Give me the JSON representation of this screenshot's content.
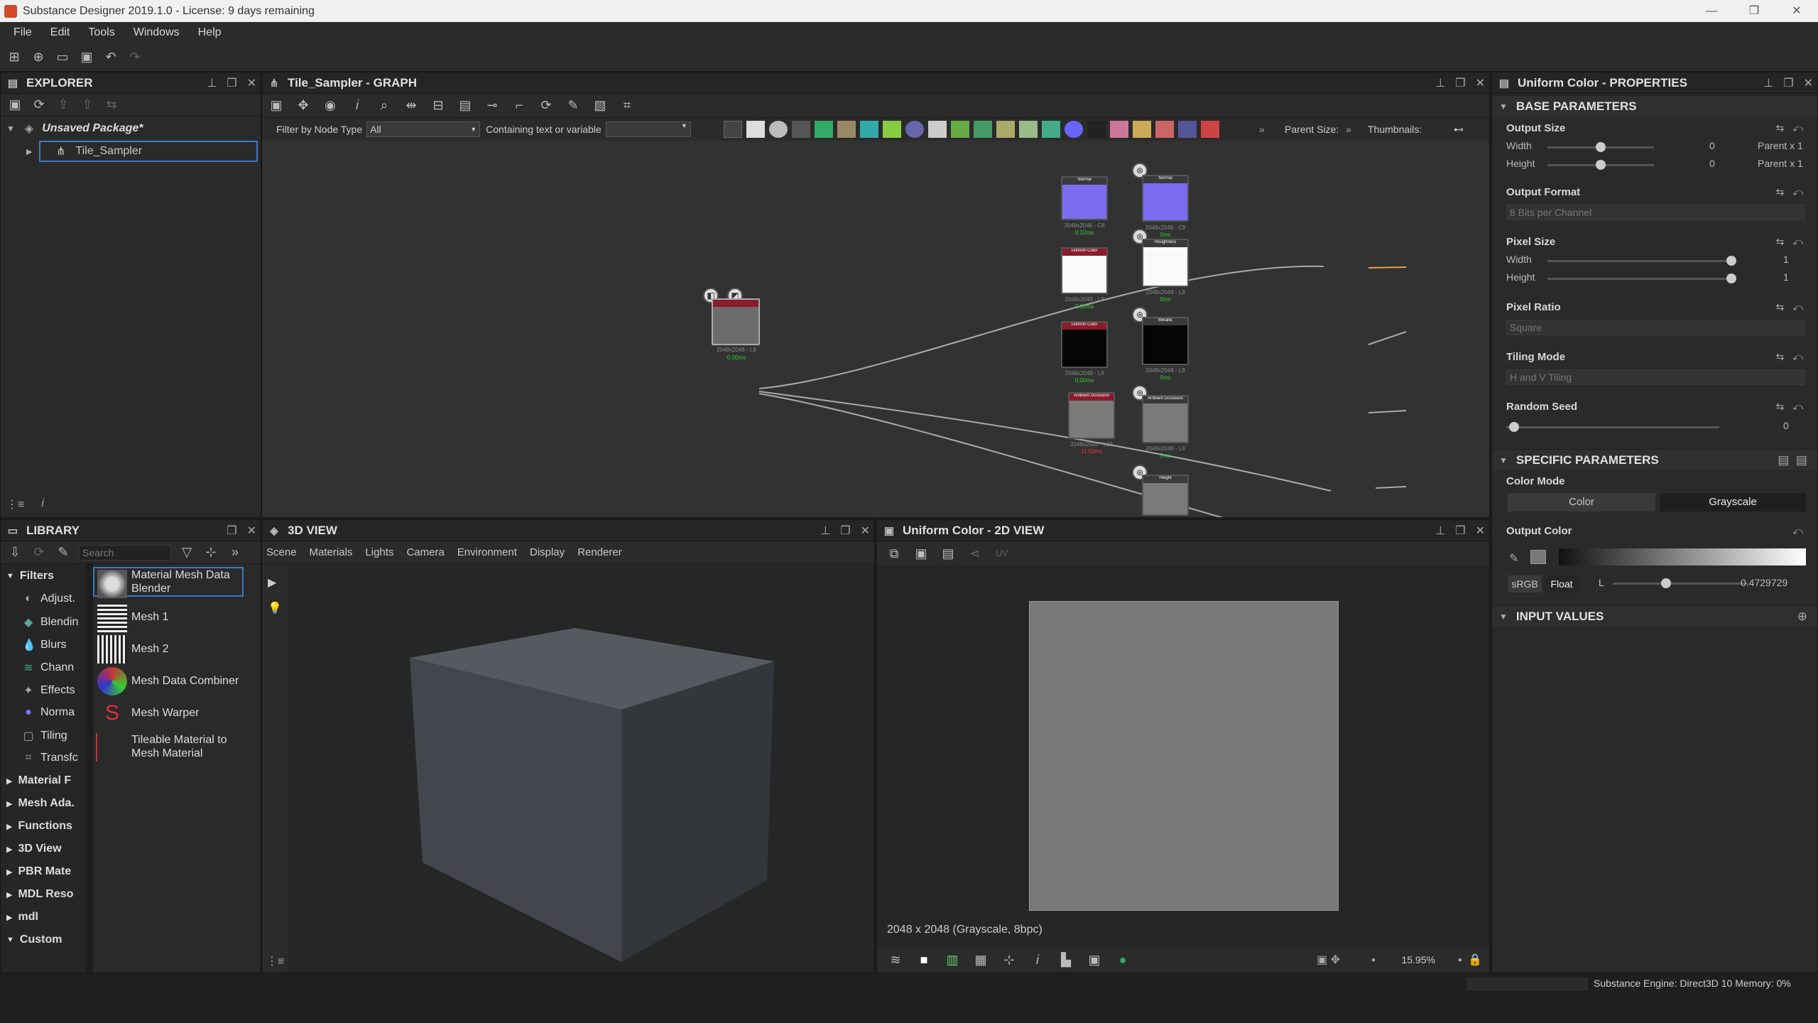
{
  "titlebar": {
    "title": "Substance Designer 2019.1.0 - License: 9 days remaining"
  },
  "menu": {
    "items": [
      "File",
      "Edit",
      "Tools",
      "Windows",
      "Help"
    ]
  },
  "explorer": {
    "title": "EXPLORER",
    "package": "Unsaved Package*",
    "graph": "Tile_Sampler"
  },
  "graph": {
    "title": "Tile_Sampler - GRAPH",
    "filter_label": "Filter by Node Type",
    "filter_value": "All",
    "containing_label": "Containing text or variable",
    "parent_size_label": "Parent Size:",
    "thumbnails_label": "Thumbnails:"
  },
  "properties": {
    "title": "Uniform Color - PROPERTIES",
    "base_parameters": "BASE PARAMETERS",
    "output_size": {
      "label": "Output Size",
      "width_label": "Width",
      "height_label": "Height",
      "width_value": "0",
      "height_value": "0",
      "width_rel": "Parent x 1",
      "height_rel": "Parent x 1"
    },
    "output_format": {
      "label": "Output Format",
      "value": "8 Bits per Channel"
    },
    "pixel_size": {
      "label": "Pixel Size",
      "width_label": "Width",
      "height_label": "Height",
      "width_value": "1",
      "height_value": "1"
    },
    "pixel_ratio": {
      "label": "Pixel Ratio",
      "value": "Square"
    },
    "tiling_mode": {
      "label": "Tiling Mode",
      "value": "H and V Tiling"
    },
    "random_seed": {
      "label": "Random Seed",
      "value": "0"
    },
    "specific_parameters": "SPECIFIC PARAMETERS",
    "color_mode": {
      "label": "Color Mode",
      "options": [
        "Color",
        "Grayscale"
      ],
      "selected": "Grayscale"
    },
    "output_color": {
      "label": "Output Color",
      "space": "sRGB",
      "format": "Float",
      "channel": "L",
      "value": "0.4729729",
      "level": 0.4729729
    },
    "input_values": "INPUT VALUES"
  },
  "library": {
    "title": "LIBRARY",
    "search_placeholder": "Search",
    "filters_label": "Filters",
    "filters": [
      "Adjust.",
      "Blendin",
      "Blurs",
      "Chann",
      "Effects",
      "Norma",
      "Tiling",
      "Transfc"
    ],
    "categories": [
      "Material F",
      "Mesh Ada.",
      "Functions",
      "3D View",
      "PBR Mate",
      "MDL Reso",
      "mdl",
      "Custom"
    ],
    "items": [
      "Material Mesh Data Blender",
      "Mesh 1",
      "Mesh 2",
      "Mesh Data Combiner",
      "Mesh Warper",
      "Tileable Material to Mesh Material"
    ]
  },
  "view3d": {
    "title": "3D VIEW",
    "menu": [
      "Scene",
      "Materials",
      "Lights",
      "Camera",
      "Environment",
      "Display",
      "Renderer"
    ]
  },
  "view2d": {
    "title": "Uniform Color - 2D VIEW",
    "info": "2048 x 2048 (Grayscale, 8bpc)",
    "zoom": "15.95%",
    "preview_color": "#787878"
  },
  "status": {
    "engine": "Substance Engine: Direct3D 10  Memory: 0%"
  },
  "colors": {
    "accent_purple": "#7b6cf0",
    "node_red": "#8a1c2c",
    "selection": "#3a78c8"
  }
}
